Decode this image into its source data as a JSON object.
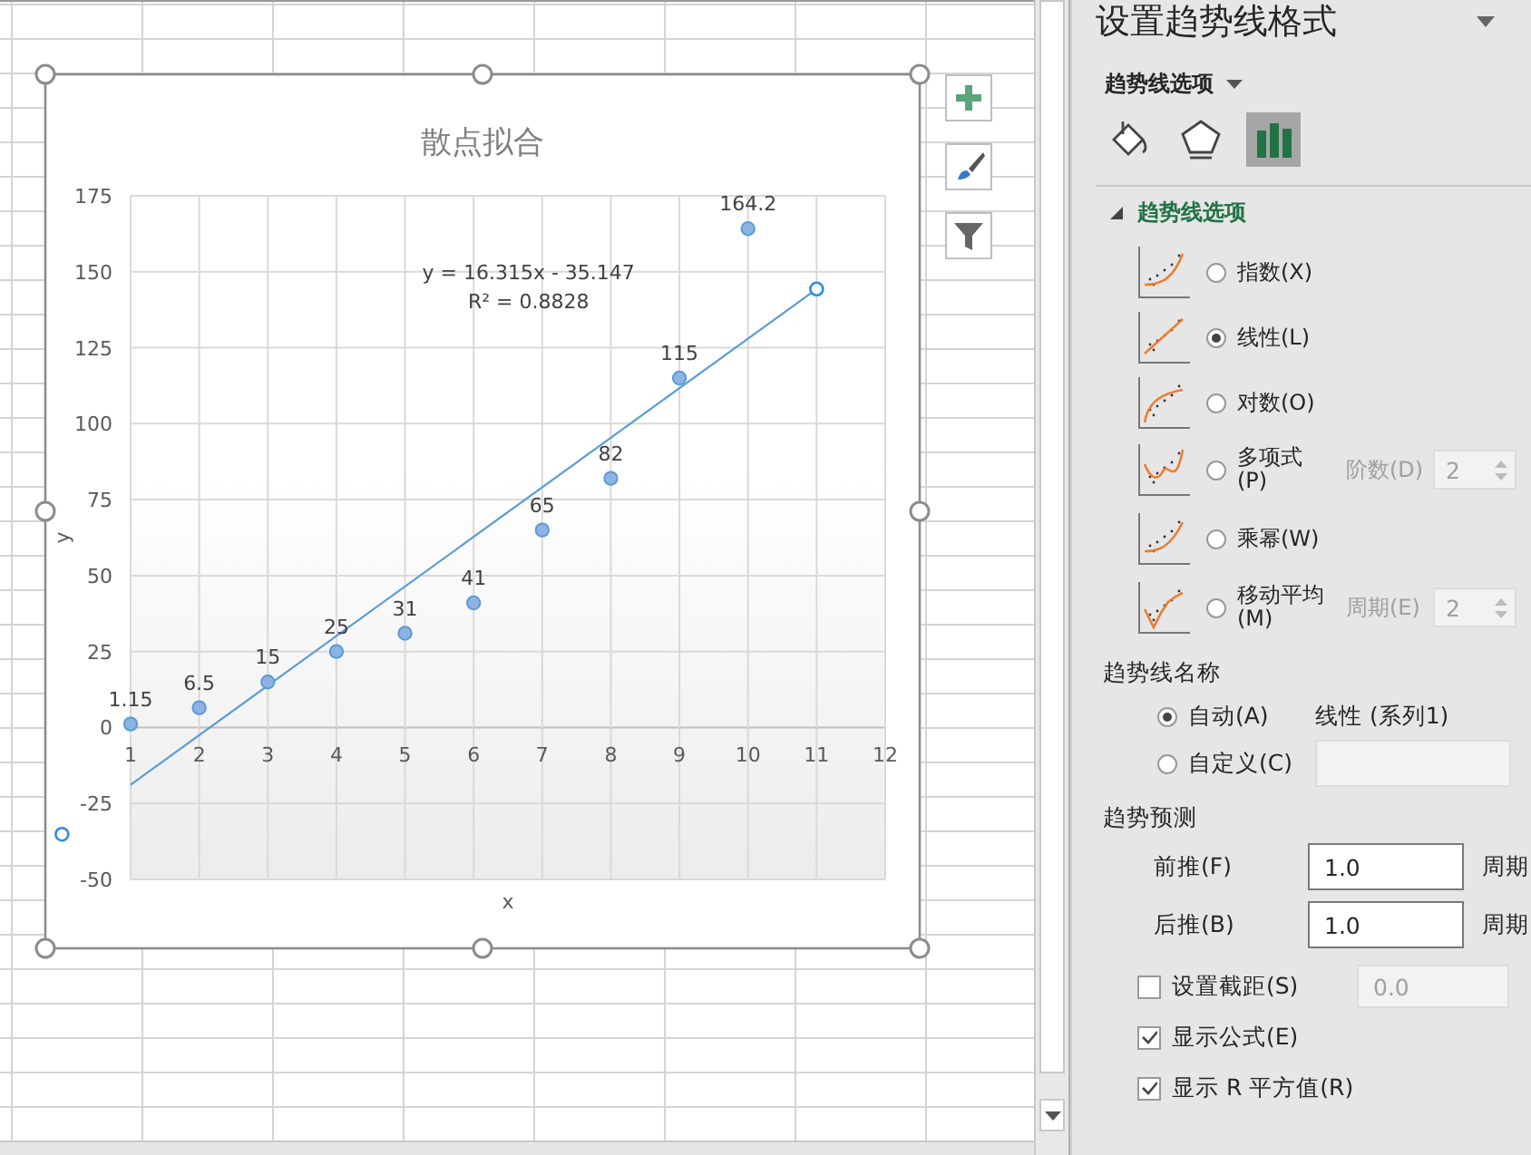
{
  "sheet": {
    "chart": {
      "chart_data": {
        "type": "scatter",
        "title": "散点拟合",
        "xlabel": "x",
        "ylabel": "y",
        "x": [
          1,
          2,
          3,
          4,
          5,
          6,
          7,
          8,
          9,
          10
        ],
        "grid": true,
        "series": [
          {
            "color": "#5b9bd5",
            "values": [
              1.15,
              6.5,
              15,
              25,
              31,
              41,
              65,
              82,
              115,
              164.2
            ]
          }
        ],
        "xlim": [
          1,
          12
        ],
        "ylim": [
          -50,
          175
        ],
        "xticks": [
          1,
          2,
          3,
          4,
          5,
          6,
          7,
          8,
          9,
          10,
          11,
          12
        ],
        "yticks": [
          -50,
          -25,
          0,
          25,
          50,
          75,
          100,
          125,
          150,
          175
        ],
        "data_labels": true,
        "annotations": [
          {
            "text": "y = 16.315x - 35.147"
          },
          {
            "text": "R² = 0.8828"
          }
        ]
      },
      "trendline": {
        "selected": true
      }
    }
  },
  "pane": {
    "title": "设置趋势线格式",
    "menu": "趋势线选项",
    "tabs": [
      {
        "selected": false
      },
      {
        "selected": false
      },
      {
        "selected": true
      }
    ],
    "section": {
      "title": "趋势线选项",
      "expanded": true
    },
    "types": [
      {
        "kind": "exponential",
        "label": "指数(X)",
        "selected": false
      },
      {
        "kind": "linear",
        "label": "线性(L)",
        "selected": true
      },
      {
        "kind": "logarithmic",
        "label": "对数(O)",
        "selected": false
      },
      {
        "kind": "polynomial",
        "label": "多项式(P)",
        "selected": false,
        "param_label": "阶数(D)",
        "param_value": "2",
        "disabled": true
      },
      {
        "kind": "power",
        "label": "乘幂(W)",
        "selected": false
      },
      {
        "kind": "moving_average",
        "label": "移动平均(M)",
        "selected": false,
        "param_label": "周期(E)",
        "param_value": "2",
        "disabled": true
      }
    ],
    "name": {
      "heading": "趋势线名称",
      "options": [
        {
          "label": "自动(A)",
          "selected": true,
          "value": "线性 (系列1)"
        },
        {
          "label": "自定义(C)",
          "selected": false,
          "field_disabled": true
        }
      ]
    },
    "forecast": {
      "heading": "趋势预测",
      "rows": [
        {
          "label": "前推(F)",
          "value": "1.0",
          "unit": "周期"
        },
        {
          "label": "后推(B)",
          "value": "1.0",
          "unit": "周期"
        }
      ]
    },
    "checks": [
      {
        "label": "设置截距(S)",
        "checked": false,
        "value": "0.0",
        "disabled": true
      },
      {
        "label": "显示公式(E)",
        "checked": true
      },
      {
        "label": "显示 R 平方值(R)",
        "checked": true
      }
    ]
  }
}
